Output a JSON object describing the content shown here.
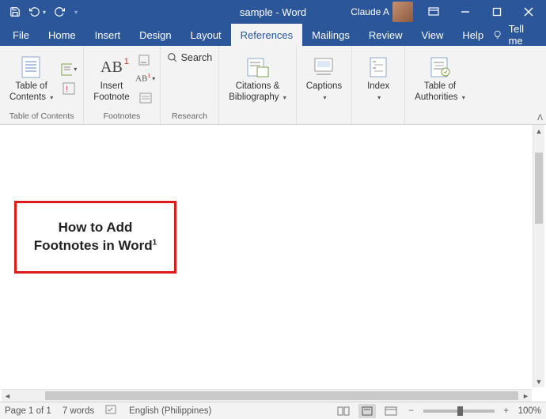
{
  "title": "sample  -  Word",
  "user": "Claude A",
  "tabs": [
    "File",
    "Home",
    "Insert",
    "Design",
    "Layout",
    "References",
    "Mailings",
    "Review",
    "View",
    "Help"
  ],
  "active_tab_index": 5,
  "tellme": "Tell me",
  "ribbon": {
    "toc": {
      "label": "Table of\nContents",
      "group": "Table of Contents"
    },
    "footnotes": {
      "insert": "Insert\nFootnote",
      "group": "Footnotes"
    },
    "research": {
      "search": "Search",
      "group": "Research"
    },
    "citations": {
      "label": "Citations &\nBibliography",
      "group": ""
    },
    "captions": {
      "label": "Captions",
      "group": ""
    },
    "index": {
      "label": "Index",
      "group": ""
    },
    "authorities": {
      "label": "Table of\nAuthorities",
      "group": ""
    }
  },
  "document": {
    "text_line1": "How to Add",
    "text_line2": "Footnotes in Word",
    "footnote_ref": "1"
  },
  "status": {
    "page": "Page 1 of 1",
    "words": "7 words",
    "lang": "English (Philippines)",
    "zoom": "100%"
  }
}
